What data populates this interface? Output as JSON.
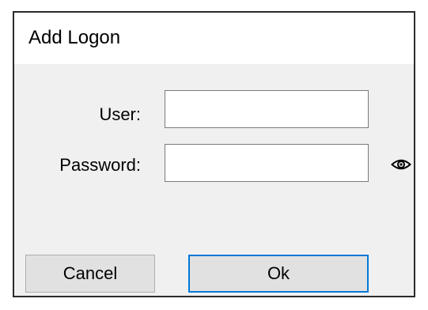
{
  "dialog": {
    "title": "Add Logon"
  },
  "form": {
    "user_label": "User:",
    "user_value": "",
    "password_label": "Password:",
    "password_value": ""
  },
  "icons": {
    "show_password": "eye-icon"
  },
  "buttons": {
    "cancel_label": "Cancel",
    "ok_label": "Ok"
  },
  "colors": {
    "focus_border": "#0078d7",
    "button_face": "#e1e1e1",
    "dialog_body": "#f0f0f0"
  }
}
